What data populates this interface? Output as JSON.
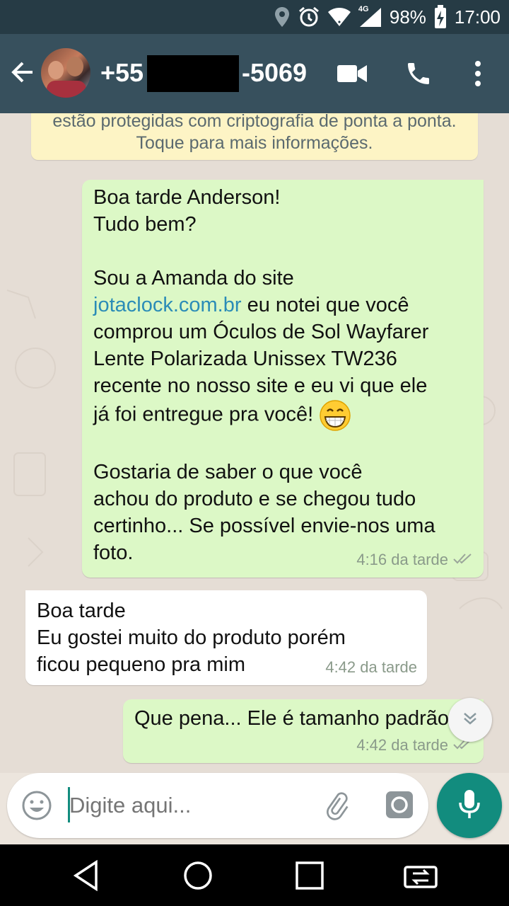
{
  "status_bar": {
    "battery": "98%",
    "time": "17:00",
    "network": "4G",
    "icons": [
      "location-icon",
      "alarm-icon",
      "wifi-icon",
      "signal-icon",
      "battery-charging-icon"
    ]
  },
  "header": {
    "contact_prefix": "+55",
    "contact_suffix": "-5069",
    "icons": [
      "back-arrow-icon",
      "video-call-icon",
      "phone-icon",
      "more-vert-icon"
    ]
  },
  "encryption_notice": {
    "line1": "estão protegidas com criptografia de ponta a ponta.",
    "line2": "Toque para mais informações."
  },
  "messages": [
    {
      "direction": "out",
      "p1": "Boa tarde Anderson!\nTudo bem?",
      "p2_before": "Sou a Amanda do site\n",
      "link": "jotaclock.com.br",
      "p2_after": " eu notei que você\ncomprou um Óculos de Sol Wayfarer\nLente Polarizada Unissex TW236\nrecente no nosso site e eu vi que ele\njá foi entregue pra você! ",
      "emoji": "grinning-face-icon",
      "p3": "Gostaria de saber o que você\nachou do produto e se chegou tudo\ncertinho... Se possível envie-nos uma\nfoto.",
      "time": "4:16 da tarde",
      "status": "double-check-icon"
    },
    {
      "direction": "in",
      "text": "Boa tarde\nEu gostei muito do produto porém\nficou pequeno pra mim",
      "time": "4:42 da tarde"
    },
    {
      "direction": "out",
      "text": "Que pena... Ele é tamanho padrão",
      "time": "4:42 da tarde",
      "status": "double-check-icon"
    }
  ],
  "composer": {
    "placeholder": "Digite aqui...",
    "icons": [
      "emoji-icon",
      "attach-icon",
      "camera-icon",
      "mic-icon"
    ]
  },
  "colors": {
    "appbar": "#37505D",
    "statusbar": "#263B45",
    "outgoing_bubble": "#DCF8C6",
    "incoming_bubble": "#FFFFFF",
    "accent": "#128C7E",
    "link": "#2B8CB7"
  }
}
